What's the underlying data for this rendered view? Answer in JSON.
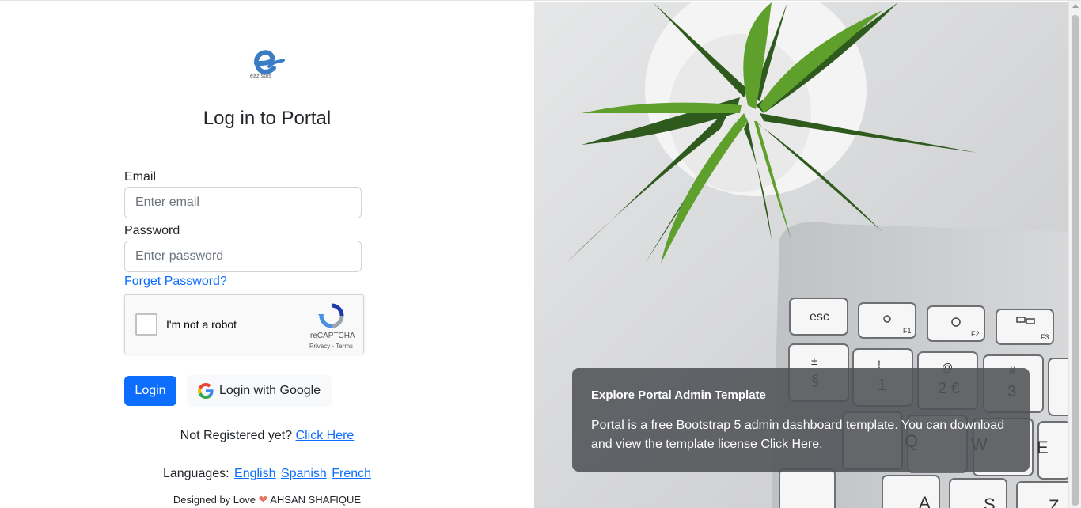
{
  "login": {
    "logo_text": "eazisols",
    "title": "Log in to Portal",
    "email_label": "Email",
    "email_placeholder": "Enter email",
    "password_label": "Password",
    "password_placeholder": "Enter password",
    "forget_password": "Forget Password?",
    "captcha": {
      "label": "I'm not a robot",
      "brand": "reCAPTCHA",
      "privacy": "Privacy",
      "separator": " - ",
      "terms": "Terms"
    },
    "login_button": "Login",
    "google_button": "Login with Google",
    "not_registered": "Not Registered yet? ",
    "register_link": "Click Here",
    "languages_label": "Languages: ",
    "languages": [
      "English",
      "Spanish",
      "French"
    ],
    "footer_prefix": "Designed by Love ",
    "footer_author": " AHSAN SHAFIQUE",
    "colors": {
      "primary": "#0d6efd",
      "heart": "#e8735e"
    },
    "icons": [
      "eazisols-logo-icon",
      "recaptcha-icon",
      "google-icon",
      "heart-icon"
    ]
  },
  "promo": {
    "title": "Explore Portal Admin Template",
    "body": "Portal is a free Bootstrap 5 admin dashboard template. You can download and view the template license ",
    "link": "Click Here",
    "trailing": ".",
    "keys": [
      "esc",
      "F1",
      "F2",
      "F3",
      "±",
      "§",
      "!",
      "1",
      "@",
      "2 €",
      "#",
      "3",
      "Q",
      "W",
      "E",
      "A",
      "S",
      "Z"
    ]
  }
}
